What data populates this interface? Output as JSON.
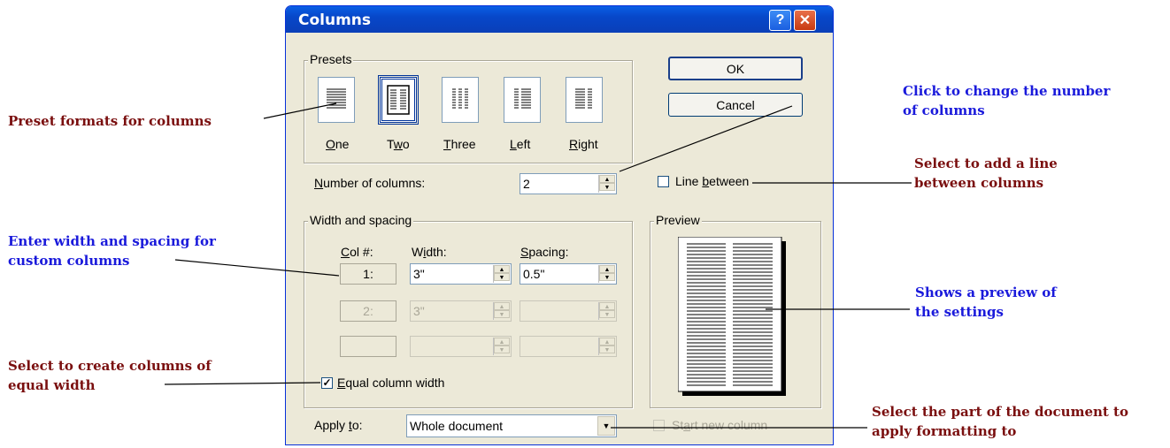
{
  "dialog": {
    "title": "Columns",
    "help_label": "?",
    "close_label": "✕",
    "presets": {
      "legend": "Presets",
      "items": [
        {
          "label_pre": "",
          "label_u": "O",
          "label_post": "ne"
        },
        {
          "label_pre": "T",
          "label_u": "w",
          "label_post": "o"
        },
        {
          "label_pre": "",
          "label_u": "T",
          "label_post": "hree"
        },
        {
          "label_pre": "",
          "label_u": "L",
          "label_post": "eft"
        },
        {
          "label_pre": "",
          "label_u": "R",
          "label_post": "ight"
        }
      ],
      "selected_index": 1
    },
    "ok_label": "OK",
    "cancel_label": "Cancel",
    "number_of_columns": {
      "label_u": "N",
      "label_rest": "umber of columns:",
      "value": "2"
    },
    "line_between": {
      "label_pre": "Line ",
      "label_u": "b",
      "label_post": "etween",
      "checked": false
    },
    "width_spacing": {
      "legend": "Width and spacing",
      "col_header_u": "C",
      "col_header_rest": "ol #:",
      "width_header_pre": "W",
      "width_header_u": "i",
      "width_header_post": "dth:",
      "spacing_header_u": "S",
      "spacing_header_rest": "pacing:",
      "rows": [
        {
          "col": "1:",
          "width": "3\"",
          "spacing": "0.5\""
        },
        {
          "col": "2:",
          "width": "3\"",
          "spacing": ""
        },
        {
          "col": "",
          "width": "",
          "spacing": ""
        }
      ]
    },
    "equal_width": {
      "label_u": "E",
      "label_rest": "qual column width",
      "checked": true
    },
    "preview": {
      "legend": "Preview"
    },
    "apply_to": {
      "label_pre": "Apply ",
      "label_u": "t",
      "label_post": "o:",
      "value": "Whole document"
    },
    "start_new_column": {
      "label_pre": "St",
      "label_u": "a",
      "label_post": "rt new column",
      "checked": false
    }
  },
  "annotations": {
    "preset": "Preset formats for columns",
    "width_spacing_1": "Enter width and spacing for",
    "width_spacing_2": "custom columns",
    "equal_1": "Select to create columns of",
    "equal_2": "equal width",
    "number_1": "Click to change the number",
    "number_2": "of columns",
    "line_1": "Select to add a line",
    "line_2": "between columns",
    "preview_1": "Shows a preview of",
    "preview_2": "the settings",
    "apply_1": "Select the part of the document to",
    "apply_2": "apply formatting to"
  },
  "colors": {
    "annotation_red": "#7a0f0f",
    "annotation_blue": "#1a1adb",
    "title_bar": "#0a52d9"
  }
}
